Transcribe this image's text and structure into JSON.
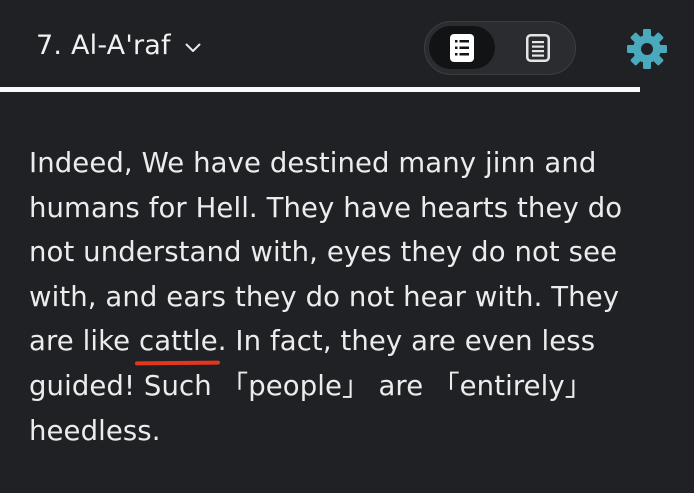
{
  "header": {
    "surah_title": "7. Al-A'raf",
    "view_modes": [
      {
        "name": "verse-by-verse",
        "icon": "list-view-icon",
        "active": true
      },
      {
        "name": "reading",
        "icon": "page-view-icon",
        "active": false
      }
    ],
    "settings_icon": "gear-icon"
  },
  "verse": {
    "text_before": "Indeed, We have destined many jinn and humans for Hell. They have hearts they do not understand with, eyes they do not see with, and ears they do not hear with. They are like ",
    "highlighted": "cattle",
    "text_after": ". In fact, they are even less guided! Such 「people」 are 「entirely」 heedless."
  },
  "colors": {
    "background": "#202124",
    "text": "#ececec",
    "accent": "#4aa9bc",
    "underline": "#e2361d"
  }
}
